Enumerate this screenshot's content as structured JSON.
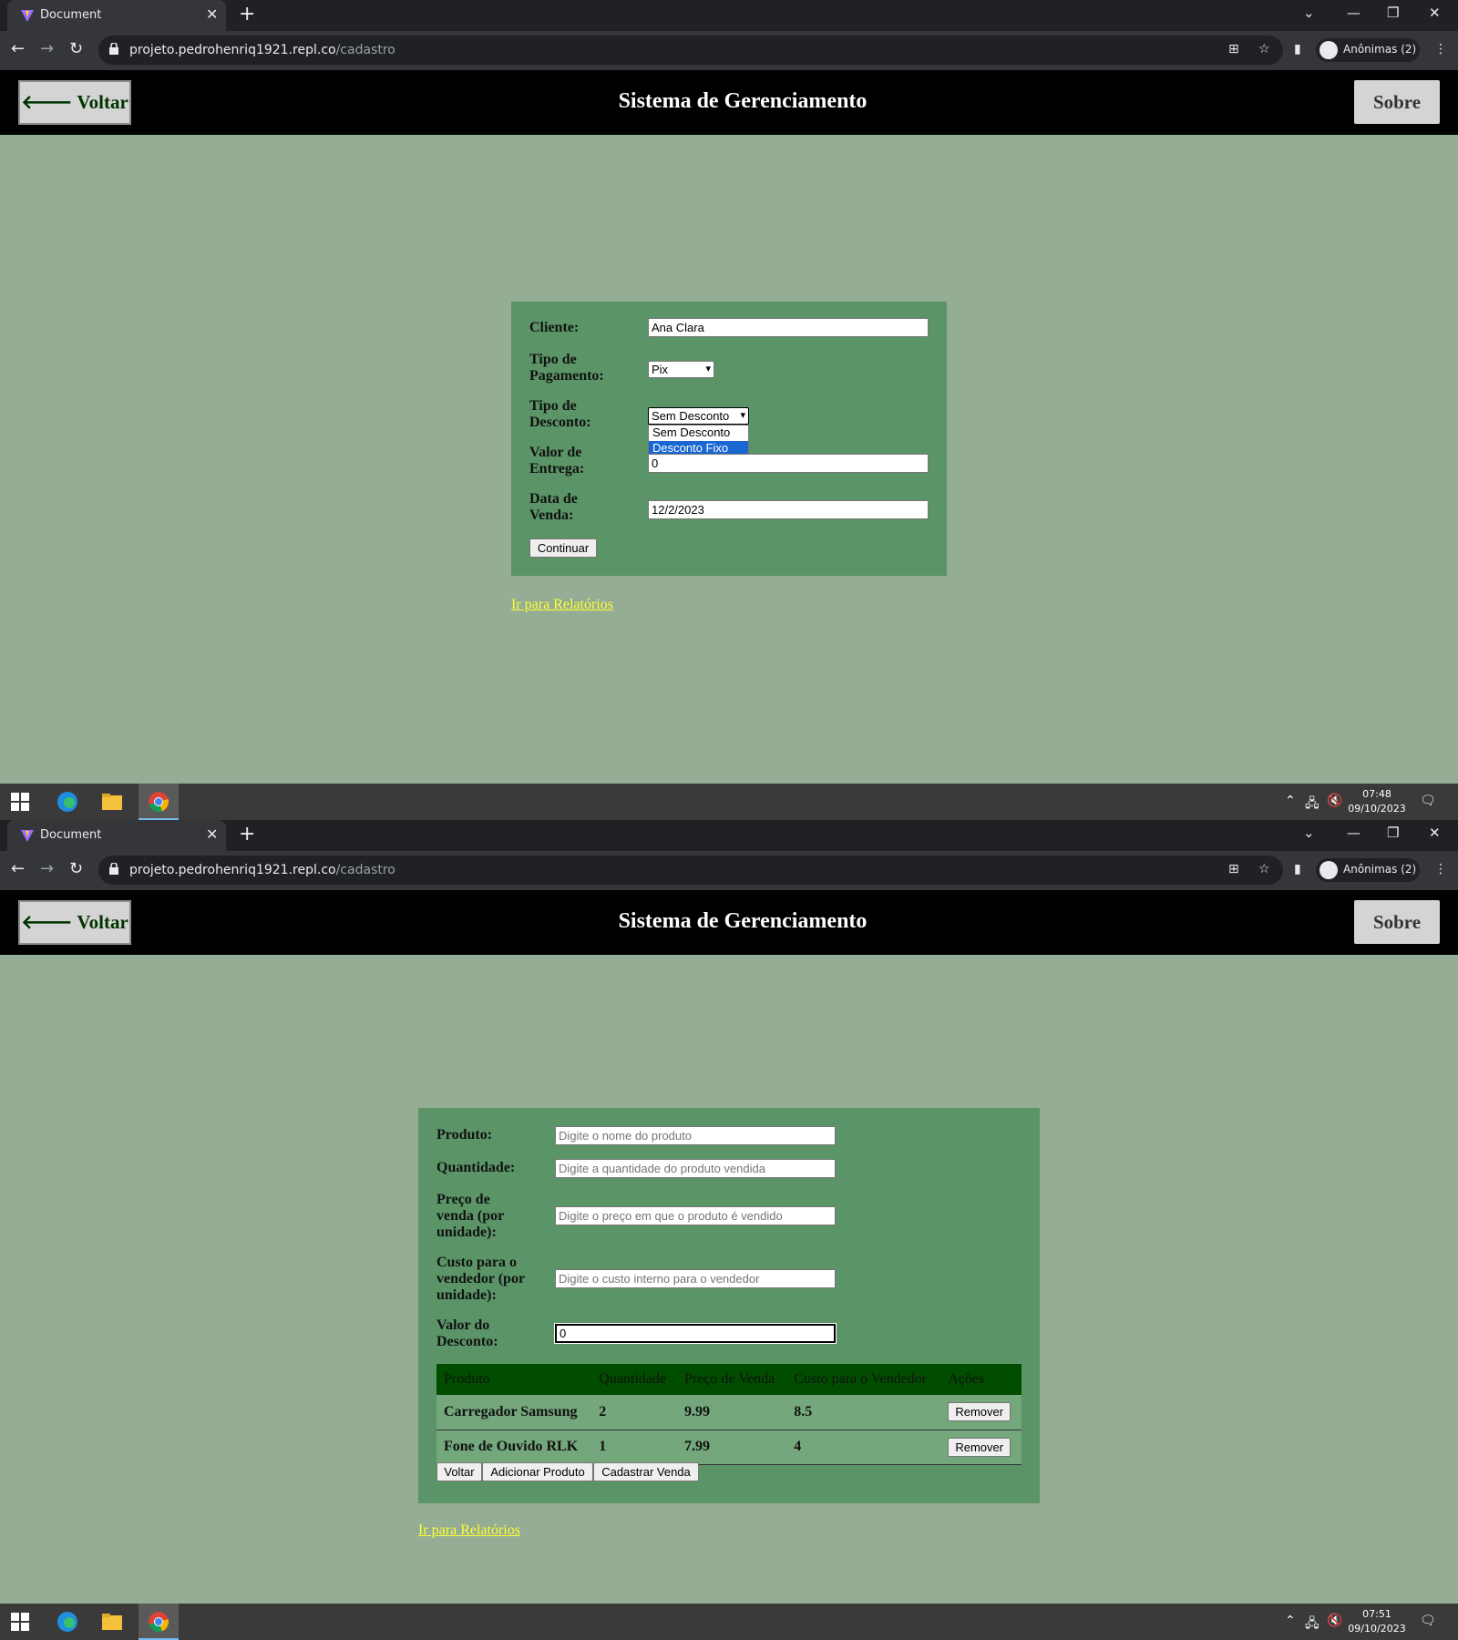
{
  "browser": {
    "tab_title": "Document",
    "new_tab": "+",
    "close_tab": "✕",
    "url_host": "projeto.pedrohenriq1921.repl.co",
    "url_path": "/cadastro",
    "profile_label": "Anônimas (2)"
  },
  "app": {
    "title": "Sistema de Gerenciamento",
    "back_label": "Voltar",
    "about_label": "Sobre",
    "reports_link": "Ir para Relatórios"
  },
  "sale_form": {
    "cliente_label": "Cliente:",
    "cliente_value": "Ana Clara",
    "pagamento_label_1": "Tipo de",
    "pagamento_label_2": "Pagamento:",
    "pagamento_value": "Pix",
    "desconto_label_1": "Tipo de",
    "desconto_label_2": "Desconto:",
    "desconto_value": "Sem Desconto",
    "desconto_options": [
      "Sem Desconto",
      "Desconto Fixo"
    ],
    "entrega_label_1": "Valor de",
    "entrega_label_2": "Entrega:",
    "entrega_value": "0",
    "data_label_1": "Data de",
    "data_label_2": "Venda:",
    "data_value": "12/2/2023",
    "continue_label": "Continuar"
  },
  "product_form": {
    "produto_label": "Produto:",
    "produto_placeholder": "Digite o nome do produto",
    "quantidade_label": "Quantidade:",
    "quantidade_placeholder": "Digite a quantidade do produto vendida",
    "preco_label_1": "Preço de",
    "preco_label_2": "venda (por",
    "preco_label_3": "unidade):",
    "preco_placeholder": "Digite o preço em que o produto é vendido",
    "custo_label_1": "Custo para o",
    "custo_label_2": "vendedor (por",
    "custo_label_3": "unidade):",
    "custo_placeholder": "Digite o custo interno para o vendedor",
    "desconto_label_1": "Valor do",
    "desconto_label_2": "Desconto:",
    "desconto_value": "0",
    "table_headers": [
      "Produto",
      "Quantidade",
      "Preço de Venda",
      "Custo para o Vendedor",
      "Ações"
    ],
    "rows": [
      {
        "produto": "Carregador Samsung",
        "quantidade": "2",
        "preco": "9.99",
        "custo": "8.5",
        "acao": "Remover"
      },
      {
        "produto": "Fone de Ouvido RLK",
        "quantidade": "1",
        "preco": "7.99",
        "custo": "4",
        "acao": "Remover"
      }
    ],
    "voltar_label": "Voltar",
    "adicionar_label": "Adicionar Produto",
    "cadastrar_label": "Cadastrar Venda"
  },
  "taskbar": {
    "screen1_time": "07:48",
    "screen1_date": "09/10/2023",
    "screen2_time": "07:51",
    "screen2_date": "09/10/2023"
  },
  "colors": {
    "page_bg": "#94ad94",
    "form_bg": "#5b9467",
    "appbar_bg": "#000000",
    "table_header_bg": "#004d00",
    "link": "#ffff33"
  }
}
